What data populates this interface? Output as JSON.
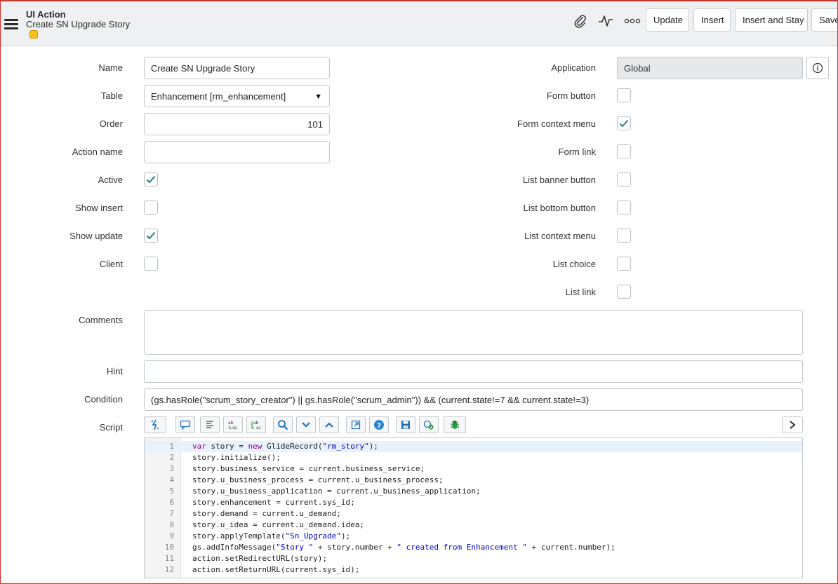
{
  "header": {
    "record_type": "UI Action",
    "record_name": "Create SN Upgrade Story",
    "buttons": {
      "update": "Update",
      "insert": "Insert",
      "insert_and_stay": "Insert and Stay",
      "save": "Save"
    },
    "icons": [
      "hamburger-menu-icon",
      "paperclip-icon",
      "activity-icon",
      "more-options-icon"
    ]
  },
  "form": {
    "left_fields": {
      "name": {
        "label": "Name",
        "value": "Create SN Upgrade Story"
      },
      "table": {
        "label": "Table",
        "value": "Enhancement [rm_enhancement]"
      },
      "order": {
        "label": "Order",
        "value": "101"
      },
      "action_name": {
        "label": "Action name",
        "value": ""
      },
      "active": {
        "label": "Active",
        "checked": true
      },
      "show_insert": {
        "label": "Show insert",
        "checked": false
      },
      "show_update": {
        "label": "Show update",
        "checked": true
      },
      "client": {
        "label": "Client",
        "checked": false
      }
    },
    "right_fields": {
      "application": {
        "label": "Application",
        "value": "Global"
      },
      "form_button": {
        "label": "Form button",
        "checked": false
      },
      "form_context_menu": {
        "label": "Form context menu",
        "checked": true
      },
      "form_link": {
        "label": "Form link",
        "checked": false
      },
      "list_banner_button": {
        "label": "List banner button",
        "checked": false
      },
      "list_bottom_button": {
        "label": "List bottom button",
        "checked": false
      },
      "list_context_menu": {
        "label": "List context menu",
        "checked": false
      },
      "list_choice": {
        "label": "List choice",
        "checked": false
      },
      "list_link": {
        "label": "List link",
        "checked": false
      }
    },
    "comments": {
      "label": "Comments",
      "value": ""
    },
    "hint": {
      "label": "Hint",
      "value": ""
    },
    "condition": {
      "label": "Condition",
      "value": "(gs.hasRole(\"scrum_story_creator\") || gs.hasRole(\"scrum_admin\")) && (current.state!=7 && current.state!=3)"
    },
    "script": {
      "label": "Script",
      "lines": [
        "var story = new GlideRecord(\"rm_story\");",
        "story.initialize();",
        "story.business_service = current.business_service;",
        "story.u_business_process = current.u_business_process;",
        "story.u_business_application = current.u_business_application;",
        "story.enhancement = current.sys_id;",
        "story.demand = current.u_demand;",
        "story.u_idea = current.u_demand.idea;",
        "story.applyTemplate(\"Sn_Upgrade\");",
        "gs.addInfoMessage(\"Story \" + story.number + \" created from Enhancement \" + current.number);",
        "action.setRedirectURL(story);",
        "action.setReturnURL(current.sys_id);"
      ]
    }
  },
  "colors": {
    "header_bg": "#eef0f2",
    "check_green": "#278380",
    "readonly_bg": "#e6e8ea",
    "frame_red": "#d9302c"
  }
}
